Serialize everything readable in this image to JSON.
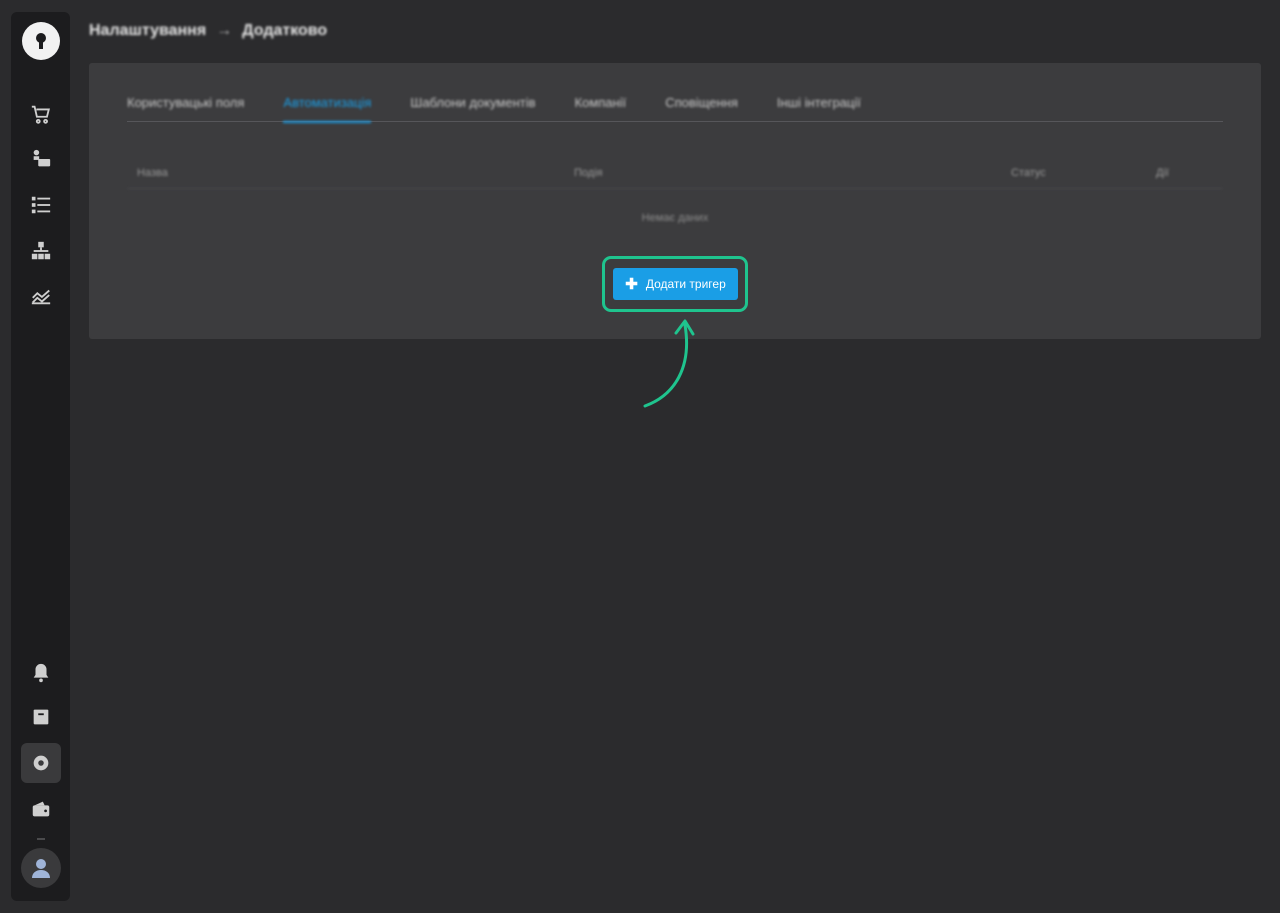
{
  "breadcrumb": {
    "parent": "Налаштування",
    "separator": "→",
    "current": "Додатково"
  },
  "sidebar": {
    "top_icons": [
      "cart-icon",
      "pay-icon",
      "list-icon",
      "hierarchy-icon",
      "chart-icon"
    ],
    "bottom_icons": [
      "bell-icon",
      "book-icon",
      "gear-icon",
      "wallet-icon"
    ],
    "active": "gear-icon"
  },
  "tabs": [
    {
      "label": "Користувацькі поля",
      "active": false
    },
    {
      "label": "Автоматизація",
      "active": true
    },
    {
      "label": "Шаблони документів",
      "active": false
    },
    {
      "label": "Компанії",
      "active": false
    },
    {
      "label": "Сповіщення",
      "active": false
    },
    {
      "label": "Інші інтеграції",
      "active": false
    }
  ],
  "table": {
    "columns": [
      "Назва",
      "Подія",
      "Статус",
      "Дії"
    ],
    "empty_text": "Немає даних"
  },
  "add_button": {
    "icon": "plus-icon",
    "label": "Додати тригер"
  },
  "colors": {
    "accent": "#1a9ee6",
    "highlight": "#1fc48e",
    "panel": "#3c3c3e",
    "sidebar": "#1c1c1e",
    "background": "#2b2b2d"
  }
}
